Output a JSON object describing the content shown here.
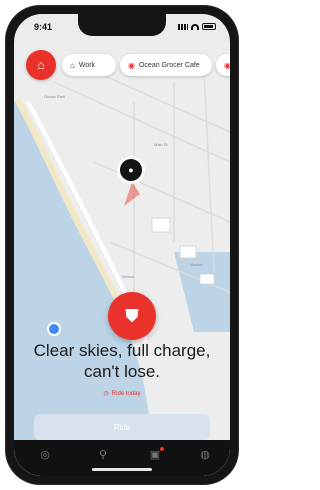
{
  "status": {
    "time": "9:41"
  },
  "topbar": {
    "logo_glyph": "⌂",
    "chips": [
      {
        "label": "Work",
        "icon": "home-icon"
      },
      {
        "label": "Ocean Grocer Cafe",
        "icon": "pin-icon"
      },
      {
        "label": "",
        "icon": "more-icon"
      }
    ]
  },
  "map": {
    "labels": [
      {
        "text": "Ocean Park"
      },
      {
        "text": "Main St"
      },
      {
        "text": "Marina"
      },
      {
        "text": "Venice"
      }
    ]
  },
  "cta": {
    "headline": "Clear skies, full charge, can't lose.",
    "sublink": "Ride today",
    "button_label": "Ride"
  },
  "colors": {
    "accent": "#e8322b",
    "water": "#bcd4e6",
    "land": "#ededed",
    "sand": "#f3e8c6"
  },
  "tabbar": {
    "items": [
      {
        "icon": "compass-icon"
      },
      {
        "icon": "scooter-icon"
      },
      {
        "icon": "gift-icon"
      },
      {
        "icon": "profile-icon"
      }
    ]
  }
}
